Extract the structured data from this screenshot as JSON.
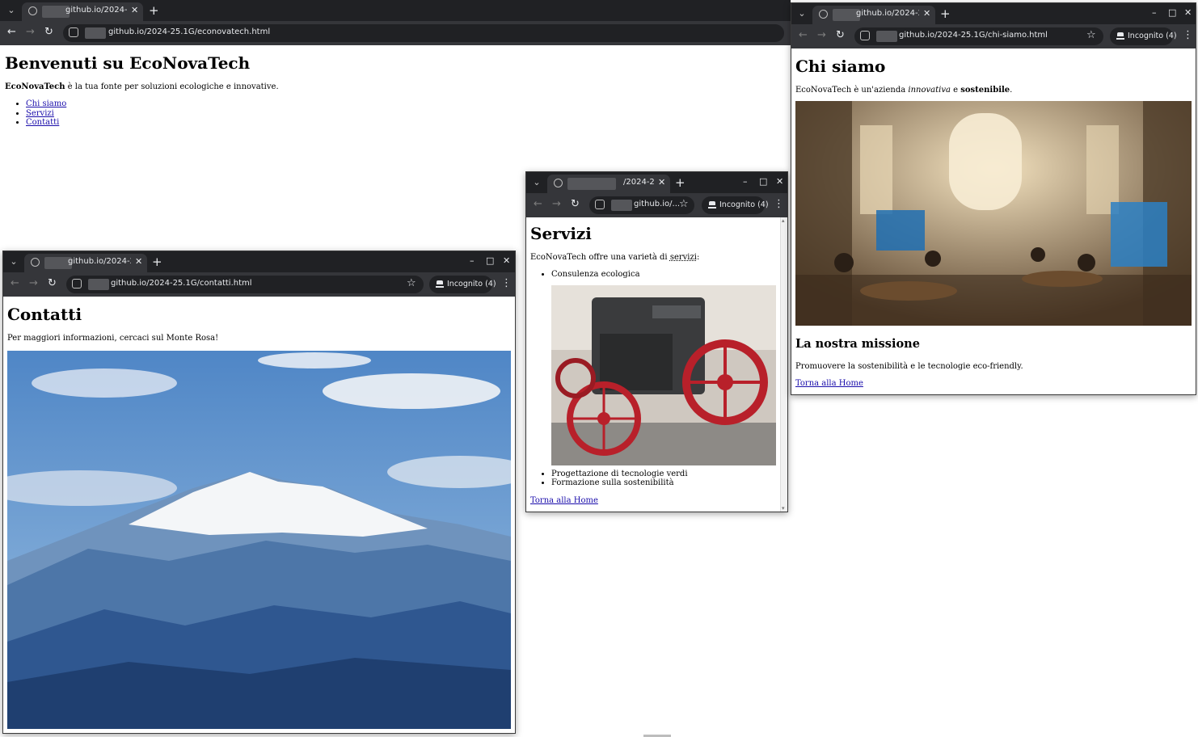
{
  "windows": {
    "home": {
      "tab_title": "github.io/2024-2",
      "url": "github.io/2024-25.1G/econovatech.html",
      "page": {
        "heading": "Benvenuti su EcoNovaTech",
        "intro_bold": "EcoNovaTech",
        "intro_rest": " è la tua fonte per soluzioni ecologiche e innovative.",
        "nav_links": [
          "Chi siamo",
          "Servizi",
          "Contatti"
        ]
      }
    },
    "contatti": {
      "tab_title": "github.io/2024-2",
      "url": "github.io/2024-25.1G/contatti.html",
      "incognito_label": "Incognito (4)",
      "page": {
        "heading": "Contatti",
        "text": "Per maggiori informazioni, cercaci sul Monte Rosa!"
      }
    },
    "servizi": {
      "tab_title": "/2024-2",
      "url": "github.io/...",
      "incognito_label": "Incognito (4)",
      "page": {
        "heading": "Servizi",
        "intro_before": "EcoNovaTech offre una varietà di ",
        "intro_abbr": "servizi",
        "intro_after": ":",
        "items": [
          "Consulenza ecologica",
          "Progettazione di tecnologie verdi",
          "Formazione sulla sostenibilità"
        ],
        "back_link": "Torna alla Home"
      }
    },
    "chi_siamo": {
      "tab_title": "github.io/2024-2",
      "url": "github.io/2024-25.1G/chi-siamo.html",
      "incognito_label": "Incognito (4)",
      "page": {
        "heading": "Chi siamo",
        "intro_a": "EcoNovaTech è un'azienda ",
        "intro_italic": "innovativa",
        "intro_b": " e ",
        "intro_bold": "sostenibile",
        "intro_c": ".",
        "mission_heading": "La nostra missione",
        "mission_text": "Promuovere la sostenibilità e le tecnologie eco-friendly.",
        "back_link": "Torna alla Home"
      }
    }
  },
  "icons": [
    "tab-list-icon",
    "globe-icon",
    "close-icon",
    "new-tab-icon",
    "back-icon",
    "forward-icon",
    "reload-icon",
    "site-settings-icon",
    "star-icon",
    "incognito-icon",
    "menu-icon",
    "minimize-icon",
    "maximize-icon"
  ],
  "chrome_colors": {
    "tabstrip": "#202124",
    "toolbar": "#35363a",
    "link": "#1a0dab"
  }
}
